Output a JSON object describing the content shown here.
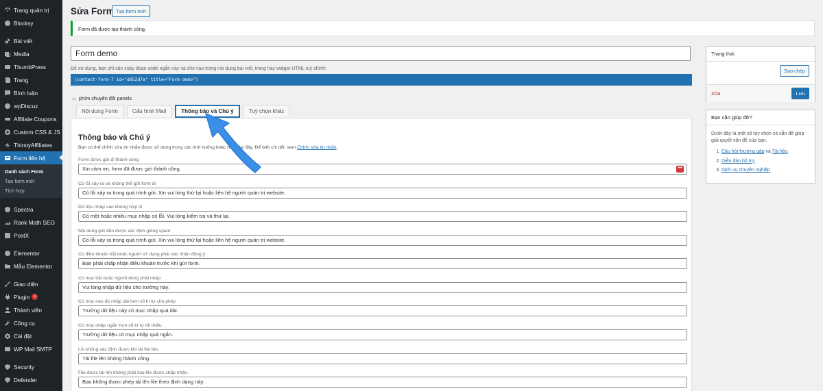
{
  "sidebar": {
    "items": [
      {
        "label": "Trang quản trị",
        "icon": "dashboard-icon"
      },
      {
        "label": "Blocksy",
        "icon": "blocksy-icon"
      },
      {
        "label": "Bài viết",
        "icon": "pin-icon"
      },
      {
        "label": "Media",
        "icon": "media-icon"
      },
      {
        "label": "ThumbPress",
        "icon": "thumbpress-icon"
      },
      {
        "label": "Trang",
        "icon": "page-icon"
      },
      {
        "label": "Bình luận",
        "icon": "comment-icon"
      },
      {
        "label": "wpDiscuz",
        "icon": "wpdiscuz-icon"
      },
      {
        "label": "Affiliate Coupons",
        "icon": "coupon-icon"
      },
      {
        "label": "Custom CSS & JS",
        "icon": "plus-circle-icon"
      },
      {
        "label": "ThirstyAffiliates",
        "icon": "link-icon"
      },
      {
        "label": "Form liên hệ",
        "icon": "mail-icon"
      },
      {
        "label": "Spectra",
        "icon": "spectra-icon"
      },
      {
        "label": "Rank Math SEO",
        "icon": "rankmath-icon"
      },
      {
        "label": "PostX",
        "icon": "postx-icon"
      },
      {
        "label": "Elementor",
        "icon": "elementor-icon"
      },
      {
        "label": "Mẫu Elementor",
        "icon": "folder-icon"
      },
      {
        "label": "Giao diện",
        "icon": "brush-icon"
      },
      {
        "label": "Plugin",
        "icon": "plugin-icon",
        "badge": "1"
      },
      {
        "label": "Thành viên",
        "icon": "users-icon"
      },
      {
        "label": "Công cụ",
        "icon": "wrench-icon"
      },
      {
        "label": "Cài đặt",
        "icon": "settings-icon"
      },
      {
        "label": "WP Mail SMTP",
        "icon": "smtp-icon"
      },
      {
        "label": "Security",
        "icon": "shield-icon"
      },
      {
        "label": "Defender",
        "icon": "defender-icon"
      }
    ],
    "submenu": [
      "Danh sách Form",
      "Tạo form mới",
      "Tích hợp"
    ]
  },
  "header": {
    "title": "Sửa Form",
    "new_button": "Tạo form mới"
  },
  "notice": "Form đã được tạo thành công.",
  "form": {
    "title_value": "Form demo",
    "shortcode_hint": "Để sử dụng, bạn chỉ cần copy đoạn code ngắn này và cho vào trong nội dung bài viết, trang hay widget HTML tuỳ chỉnh:",
    "shortcode": "[contact-form-7 id=\"d052d7a\" title=\"Form demo\"]",
    "panel_toggle": "phím chuyển đổi panels"
  },
  "tabs": [
    {
      "label": "Nội dung Form"
    },
    {
      "label": "Cấu hình Mail"
    },
    {
      "label": "Thông báo và Chú ý"
    },
    {
      "label": "Tuỳ chọn khác"
    }
  ],
  "panel": {
    "heading": "Thông báo và Chú ý",
    "desc_prefix": "Bạn có thể chỉnh sửa tin nhắn được sử dụng trong các tình huống khác nhau tại đây. Để biết chi tiết, xem ",
    "desc_link": "Chỉnh sửa tin nhắn",
    "desc_suffix": ".",
    "fields": [
      {
        "label": "Form được gửi đi thành công",
        "value": "Xin cảm ơn, form đã được gửi thành công."
      },
      {
        "label": "Có lỗi xảy ra và không thể gửi form đi",
        "value": "Có lỗi xảy ra trong quá trình gửi. Xin vui lòng thử lại hoặc liên hệ người quản trị website."
      },
      {
        "label": "Dữ liệu nhập vào không hợp lệ",
        "value": "Có một hoặc nhiều mục nhập có lỗi. Vui lòng kiểm tra và thử lại."
      },
      {
        "label": "Nội dung gửi đến được xác định giống spam",
        "value": "Có lỗi xảy ra trong quá trình gửi. Xin vui lòng thử lại hoặc liên hệ người quản trị website."
      },
      {
        "label": "Có điều khoản bắt buộc người sử dụng phải xác nhận đồng ý",
        "value": "Bạn phải chấp nhận điều khoản trước khi gửi form."
      },
      {
        "label": "Có mục bắt buộc người dùng phải nhập",
        "value": "Vui lòng nhập dữ liệu cho trường này."
      },
      {
        "label": "Có mục nào đó nhập dài hơn số kí tự cho phép",
        "value": "Trường dữ liệu này có mục nhập quá dài."
      },
      {
        "label": "Có mục nhập ngắn hơn số kí tự tối thiểu",
        "value": "Trường dữ liệu có mục nhập quá ngắn."
      },
      {
        "label": "Lỗi không xác định được khi tải file lên.",
        "value": "Tải file lên không thành công."
      },
      {
        "label": "File được tải lên không phải loại file được chấp nhận.",
        "value": "Bạn không được phép tải lên file theo định dạng này."
      }
    ]
  },
  "status_box": {
    "title": "Trạng thái",
    "copy_button": "Sao chép",
    "delete_link": "Xóa",
    "save_button": "Lưu"
  },
  "help_box": {
    "title": "Bạn cần giúp đỡ?",
    "text": "Dưới đây là một số tùy chọn có sẵn để giúp giải quyết vấn đề của bạn.",
    "items": [
      {
        "link1": "Câu hỏi thường gặp",
        "joiner": " và ",
        "link2": "Tài liệu",
        "tail": "."
      },
      {
        "link1": "Diễn đàn hỗ trợ"
      },
      {
        "link1": "Dịch vụ chuyên nghiệp"
      }
    ]
  },
  "colors": {
    "accent": "#2271b1",
    "sidebar_bg": "#1d2327",
    "success": "#00a32a",
    "danger": "#d63638"
  }
}
